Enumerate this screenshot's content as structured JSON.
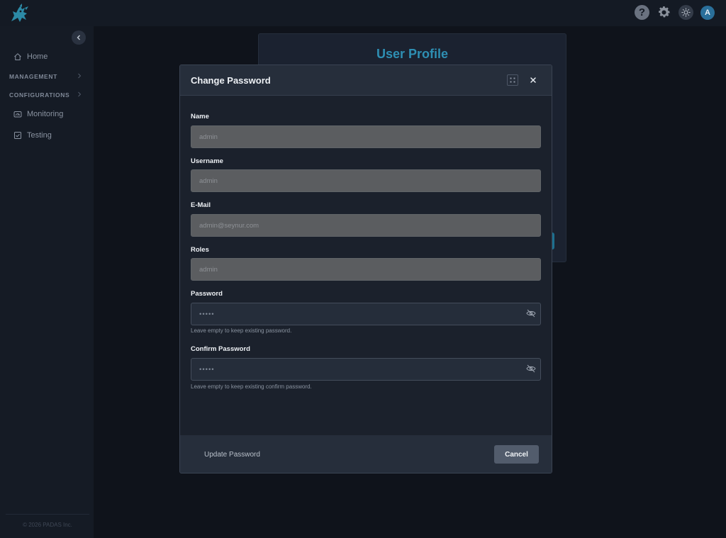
{
  "topbar": {
    "help_glyph": "?",
    "avatar_initial": "A",
    "icons": [
      "logo-icon",
      "help-icon",
      "gear-icon",
      "sun-icon",
      "avatar"
    ]
  },
  "sidebar": {
    "home": "Home",
    "management": "MANAGEMENT",
    "configurations": "CONFIGURATIONS",
    "monitoring": "Monitoring",
    "testing": "Testing",
    "footer": "© 2026 PADAS Inc."
  },
  "profile": {
    "title": "User Profile"
  },
  "modal": {
    "title": "Change Password",
    "name_label": "Name",
    "name_value": "admin",
    "username_label": "Username",
    "username_value": "admin",
    "email_label": "E-Mail",
    "email_value": "admin@seynur.com",
    "roles_label": "Roles",
    "roles_value": "admin",
    "password_label": "Password",
    "password_value": "•••••",
    "password_help": "Leave empty to keep existing password.",
    "confirm_label": "Confirm Password",
    "confirm_value": "•••••",
    "confirm_help": "Leave empty to keep existing confirm password.",
    "update_label": "Update Password",
    "cancel_label": "Cancel"
  },
  "colors": {
    "accent": "#2e8fb3",
    "modal_bg": "#1b212c",
    "readonly_field": "#5b5d60"
  }
}
